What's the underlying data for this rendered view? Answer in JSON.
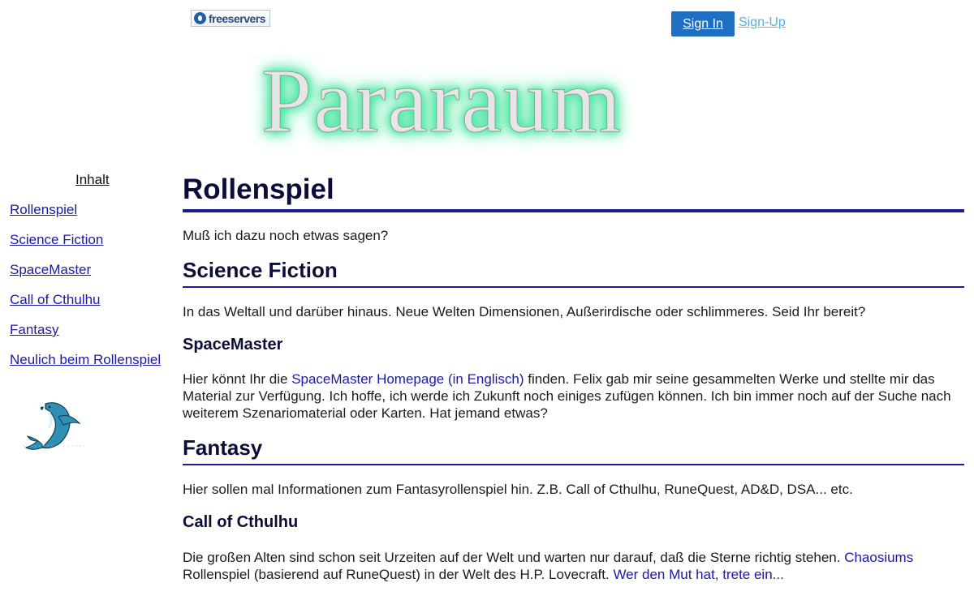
{
  "topbar": {
    "logo_text": "freeservers",
    "signin_label": "Sign In",
    "signup_label": "Sign-Up"
  },
  "banner": {
    "text": "Pararaum"
  },
  "sidebar": {
    "heading": "Inhalt",
    "items": [
      {
        "label": "Rollenspiel"
      },
      {
        "label": "Science Fiction"
      },
      {
        "label": "SpaceMaster"
      },
      {
        "label": "Call of Cthulhu"
      },
      {
        "label": "Fantasy"
      },
      {
        "label": "Neulich beim Rollenspiel"
      }
    ]
  },
  "main": {
    "title": "Rollenspiel",
    "intro": "Muß ich dazu noch etwas sagen?",
    "scifi": {
      "heading": "Science Fiction",
      "text": "In das Weltall und darüber hinaus. Neue Welten Dimensionen, Außerirdische oder schlimmeres. Seid Ihr bereit?"
    },
    "spacemaster": {
      "heading": "SpaceMaster",
      "text_before": "Hier könnt Ihr die ",
      "link": "SpaceMaster Homepage (in Englisch)",
      "text_after": " finden. Felix gab mir seine gesammelten Werke und stellte mir das Material zur Verfügung. Ich hoffe, ich werde ich Zukunft noch einiges zufügen können. Ich bin immer noch auf der Suche nach weiterem Szenariomaterial oder Karten. Hat jemand etwas?"
    },
    "fantasy": {
      "heading": "Fantasy",
      "text": "Hier sollen mal Informationen zum Fantasyrollenspiel hin. Z.B. Call of Cthulhu, RuneQuest, AD&D, DSA... etc."
    },
    "cthulhu": {
      "heading": "Call of Cthulhu",
      "text_before": "Die großen Alten sind schon seit Urzeiten auf der Welt und warten nur darauf, daß die Sterne richtig stehen. ",
      "link1": "Chaosiums",
      "text_middle": " Rollenspiel (basierend auf RuneQuest) in der Welt des H.P. Lovecraft. ",
      "link2": "Wer den Mut hat, trete ein..."
    }
  },
  "colors": {
    "heading": "#0c0c3a",
    "rule": "#1a1a9a",
    "link": "#1a1aa6",
    "signin_bg": "#1e6fc2",
    "signup": "#5aaee0",
    "banner_glow": "#22e890"
  }
}
